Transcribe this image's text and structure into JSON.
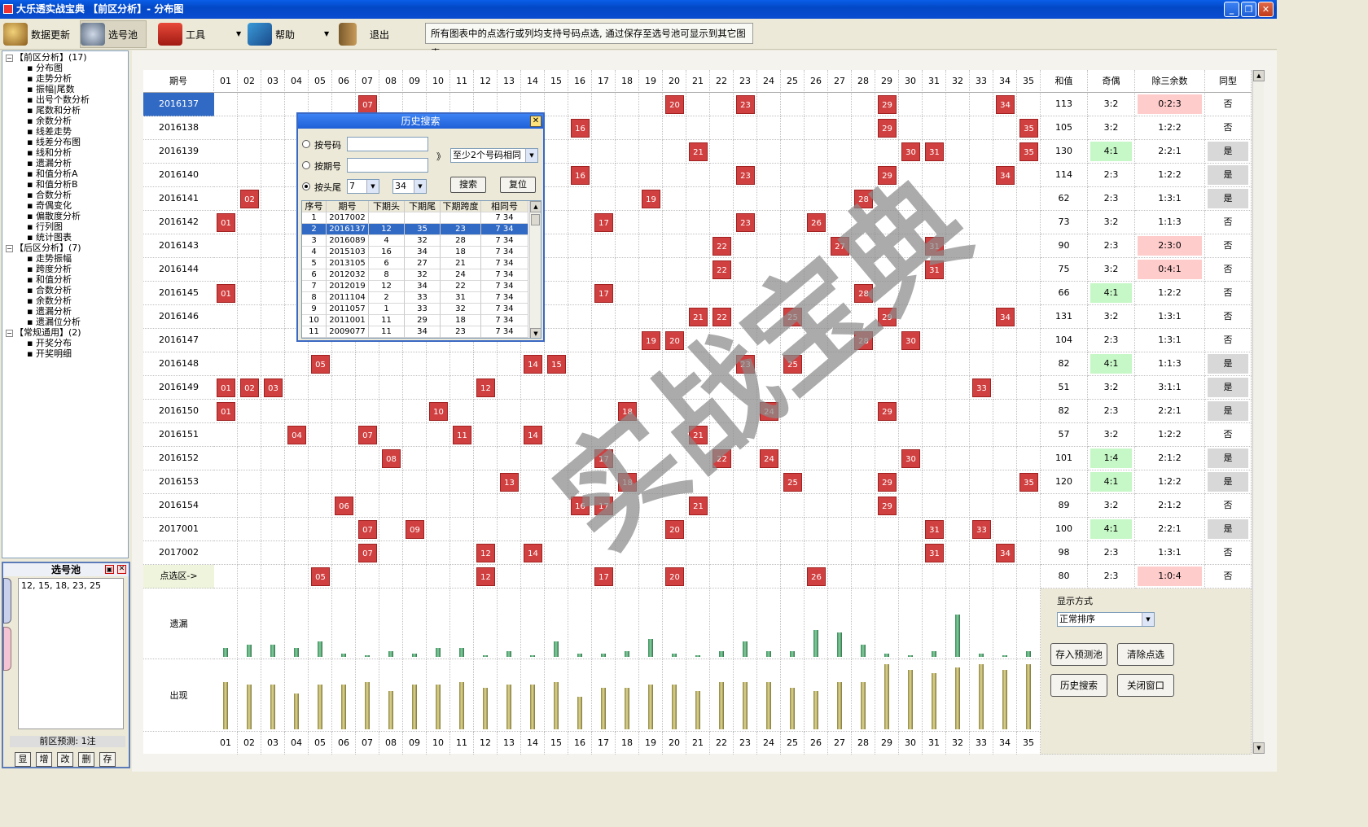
{
  "window": {
    "title": "大乐透实战宝典  【前区分析】- 分布图",
    "controls": [
      "_",
      "❐",
      "✕"
    ]
  },
  "toolbar": {
    "items": [
      {
        "label": "数据更新",
        "icon": "data-update-icon"
      },
      {
        "label": "选号池",
        "icon": "number-pool-icon"
      },
      {
        "label": "工具",
        "icon": "toolbox-icon"
      },
      {
        "label": "帮助",
        "icon": "help-book-icon"
      },
      {
        "label": "退出",
        "icon": "exit-door-icon"
      }
    ],
    "hint": "所有图表中的点选行或列均支持号码点选, 通过保存至选号池可显示到其它图表"
  },
  "tree": {
    "groups": [
      {
        "label": "【前区分析】(17)",
        "items": [
          "分布图",
          "走势分析",
          "振幅|尾数",
          "出号个数分析",
          "尾数和分析",
          "余数分析",
          "线差走势",
          "线差分布图",
          "线和分析",
          "遗漏分析",
          "和值分析A",
          "和值分析B",
          "合数分析",
          "奇偶变化",
          "偏散度分析",
          "行列图",
          "统计图表"
        ]
      },
      {
        "label": "【后区分析】(7)",
        "items": [
          "走势振幅",
          "跨度分析",
          "和值分析",
          "合数分析",
          "余数分析",
          "遗漏分析",
          "遗漏位分析"
        ]
      },
      {
        "label": "【常规通用】(2)",
        "items": [
          "开奖分布",
          "开奖明细"
        ]
      }
    ]
  },
  "pool": {
    "title": "选号池",
    "numbers": "12, 15, 18, 23, 25",
    "status": "前区预测: 1注",
    "buttons": [
      "显",
      "增",
      "改",
      "删",
      "存"
    ]
  },
  "grid": {
    "period_header": "期号",
    "columns": [
      "01",
      "02",
      "03",
      "04",
      "05",
      "06",
      "07",
      "08",
      "09",
      "10",
      "11",
      "12",
      "13",
      "14",
      "15",
      "16",
      "17",
      "18",
      "19",
      "20",
      "21",
      "22",
      "23",
      "24",
      "25",
      "26",
      "27",
      "28",
      "29",
      "30",
      "31",
      "32",
      "33",
      "34",
      "35"
    ],
    "stat_headers": [
      "和值",
      "奇偶",
      "除三余数",
      "同型"
    ],
    "rows": [
      {
        "period": "2016137",
        "nums": [
          "07",
          "20",
          "23",
          "29",
          "34"
        ],
        "sum": "113",
        "oe": "3:2",
        "mod3": "0:2:3",
        "same": "否",
        "oe_hl": "",
        "mod3_hl": "red",
        "same_hl": ""
      },
      {
        "period": "2016138",
        "nums": [
          "16",
          "29",
          "35"
        ],
        "sum": "105",
        "oe": "3:2",
        "mod3": "1:2:2",
        "same": "否",
        "oe_hl": "",
        "mod3_hl": "",
        "same_hl": ""
      },
      {
        "period": "2016139",
        "nums": [
          "21",
          "30",
          "31",
          "35"
        ],
        "sum": "130",
        "oe": "4:1",
        "mod3": "2:2:1",
        "same": "是",
        "oe_hl": "green",
        "mod3_hl": "",
        "same_hl": "gray"
      },
      {
        "period": "2016140",
        "nums": [
          "16",
          "23",
          "29",
          "34"
        ],
        "sum": "114",
        "oe": "2:3",
        "mod3": "1:2:2",
        "same": "是",
        "oe_hl": "",
        "mod3_hl": "",
        "same_hl": "gray"
      },
      {
        "period": "2016141",
        "nums": [
          "02",
          "19",
          "28"
        ],
        "sum": "62",
        "oe": "2:3",
        "mod3": "1:3:1",
        "same": "是",
        "oe_hl": "",
        "mod3_hl": "",
        "same_hl": "gray"
      },
      {
        "period": "2016142",
        "nums": [
          "01",
          "17",
          "23",
          "26"
        ],
        "sum": "73",
        "oe": "3:2",
        "mod3": "1:1:3",
        "same": "否",
        "oe_hl": "",
        "mod3_hl": "",
        "same_hl": ""
      },
      {
        "period": "2016143",
        "nums": [
          "22",
          "27",
          "31"
        ],
        "sum": "90",
        "oe": "2:3",
        "mod3": "2:3:0",
        "same": "否",
        "oe_hl": "",
        "mod3_hl": "red",
        "same_hl": ""
      },
      {
        "period": "2016144",
        "nums": [
          "22",
          "31"
        ],
        "sum": "75",
        "oe": "3:2",
        "mod3": "0:4:1",
        "same": "否",
        "oe_hl": "",
        "mod3_hl": "red",
        "same_hl": ""
      },
      {
        "period": "2016145",
        "nums": [
          "01",
          "17",
          "28"
        ],
        "sum": "66",
        "oe": "4:1",
        "mod3": "1:2:2",
        "same": "否",
        "oe_hl": "green",
        "mod3_hl": "",
        "same_hl": ""
      },
      {
        "period": "2016146",
        "nums": [
          "21",
          "22",
          "25",
          "29",
          "34"
        ],
        "sum": "131",
        "oe": "3:2",
        "mod3": "1:3:1",
        "same": "否",
        "oe_hl": "",
        "mod3_hl": "",
        "same_hl": ""
      },
      {
        "period": "2016147",
        "nums": [
          "19",
          "20",
          "28",
          "30"
        ],
        "sum": "104",
        "oe": "2:3",
        "mod3": "1:3:1",
        "same": "否",
        "oe_hl": "",
        "mod3_hl": "",
        "same_hl": ""
      },
      {
        "period": "2016148",
        "nums": [
          "05",
          "14",
          "15",
          "23",
          "25"
        ],
        "sum": "82",
        "oe": "4:1",
        "mod3": "1:1:3",
        "same": "是",
        "oe_hl": "green",
        "mod3_hl": "",
        "same_hl": "gray"
      },
      {
        "period": "2016149",
        "nums": [
          "01",
          "02",
          "03",
          "12",
          "33"
        ],
        "sum": "51",
        "oe": "3:2",
        "mod3": "3:1:1",
        "same": "是",
        "oe_hl": "",
        "mod3_hl": "",
        "same_hl": "gray"
      },
      {
        "period": "2016150",
        "nums": [
          "01",
          "10",
          "18",
          "24",
          "29"
        ],
        "sum": "82",
        "oe": "2:3",
        "mod3": "2:2:1",
        "same": "是",
        "oe_hl": "",
        "mod3_hl": "",
        "same_hl": "gray"
      },
      {
        "period": "2016151",
        "nums": [
          "04",
          "07",
          "11",
          "14",
          "21"
        ],
        "sum": "57",
        "oe": "3:2",
        "mod3": "1:2:2",
        "same": "否",
        "oe_hl": "",
        "mod3_hl": "",
        "same_hl": ""
      },
      {
        "period": "2016152",
        "nums": [
          "08",
          "17",
          "22",
          "24",
          "30"
        ],
        "sum": "101",
        "oe": "1:4",
        "mod3": "2:1:2",
        "same": "是",
        "oe_hl": "green",
        "mod3_hl": "",
        "same_hl": "gray"
      },
      {
        "period": "2016153",
        "nums": [
          "13",
          "18",
          "25",
          "29",
          "35"
        ],
        "sum": "120",
        "oe": "4:1",
        "mod3": "1:2:2",
        "same": "是",
        "oe_hl": "green",
        "mod3_hl": "",
        "same_hl": "gray"
      },
      {
        "period": "2016154",
        "nums": [
          "06",
          "16",
          "17",
          "21",
          "29"
        ],
        "sum": "89",
        "oe": "3:2",
        "mod3": "2:1:2",
        "same": "否",
        "oe_hl": "",
        "mod3_hl": "",
        "same_hl": ""
      },
      {
        "period": "2017001",
        "nums": [
          "07",
          "09",
          "20",
          "31",
          "33"
        ],
        "sum": "100",
        "oe": "4:1",
        "mod3": "2:2:1",
        "same": "是",
        "oe_hl": "green",
        "mod3_hl": "",
        "same_hl": "gray"
      },
      {
        "period": "2017002",
        "nums": [
          "07",
          "12",
          "14",
          "31",
          "34"
        ],
        "sum": "98",
        "oe": "2:3",
        "mod3": "1:3:1",
        "same": "否",
        "oe_hl": "",
        "mod3_hl": "",
        "same_hl": ""
      }
    ],
    "pick_row": {
      "label": "点选区->",
      "nums": [
        "05",
        "12",
        "17",
        "20",
        "26"
      ],
      "sum": "80",
      "oe": "2:3",
      "mod3": "1:0:4",
      "same": "否",
      "mod3_hl": "red"
    },
    "omission_label": "遗漏",
    "appear_label": "出现",
    "omission_values": [
      3,
      4,
      4,
      3,
      5,
      1,
      0,
      2,
      1,
      3,
      3,
      0,
      2,
      0,
      5,
      1,
      1,
      2,
      6,
      1,
      0,
      2,
      5,
      2,
      2,
      9,
      8,
      4,
      1,
      0,
      2,
      14,
      1,
      0,
      2
    ],
    "appear_values": [
      16,
      15,
      15,
      12,
      15,
      15,
      16,
      13,
      15,
      15,
      16,
      14,
      15,
      15,
      16,
      11,
      14,
      14,
      15,
      15,
      13,
      16,
      16,
      16,
      14,
      13,
      16,
      16,
      22,
      20,
      19,
      21,
      22,
      20,
      22
    ]
  },
  "right_panel": {
    "display_label": "显示方式",
    "display_value": "正常排序",
    "buttons": [
      "存入预测池",
      "清除点选",
      "历史搜索",
      "关闭窗口"
    ]
  },
  "dialog": {
    "title": "历史搜索",
    "opt_number": "按号码",
    "opt_period": "按期号",
    "opt_headtail": "按头尾",
    "arrow": "》",
    "match_mode": "至少2个号码相同",
    "head_value": "7",
    "tail_value": "34",
    "search_btn": "搜索",
    "reset_btn": "复位",
    "table_headers": [
      "序号",
      "期号",
      "下期头",
      "下期尾",
      "下期跨度",
      "相同号"
    ],
    "table_rows": [
      [
        "1",
        "2017002",
        "",
        "",
        "",
        "7 34"
      ],
      [
        "2",
        "2016137",
        "12",
        "35",
        "23",
        "7 34"
      ],
      [
        "3",
        "2016089",
        "4",
        "32",
        "28",
        "7 34"
      ],
      [
        "4",
        "2015103",
        "16",
        "34",
        "18",
        "7 34"
      ],
      [
        "5",
        "2013105",
        "6",
        "27",
        "21",
        "7 34"
      ],
      [
        "6",
        "2012032",
        "8",
        "32",
        "24",
        "7 34"
      ],
      [
        "7",
        "2012019",
        "12",
        "34",
        "22",
        "7 34"
      ],
      [
        "8",
        "2011104",
        "2",
        "33",
        "31",
        "7 34"
      ],
      [
        "9",
        "2011057",
        "1",
        "33",
        "32",
        "7 34"
      ],
      [
        "10",
        "2011001",
        "11",
        "29",
        "18",
        "7 34"
      ],
      [
        "11",
        "2009077",
        "11",
        "34",
        "23",
        "7 34"
      ]
    ],
    "selected_row": 1
  },
  "watermark": "实战宝典",
  "colors": {
    "ball": "#d04040",
    "green_hl": "#c6f7c6",
    "red_hl": "#ffcccc",
    "gray_hl": "#d8d8d8",
    "selected_period": "#316ac5"
  }
}
